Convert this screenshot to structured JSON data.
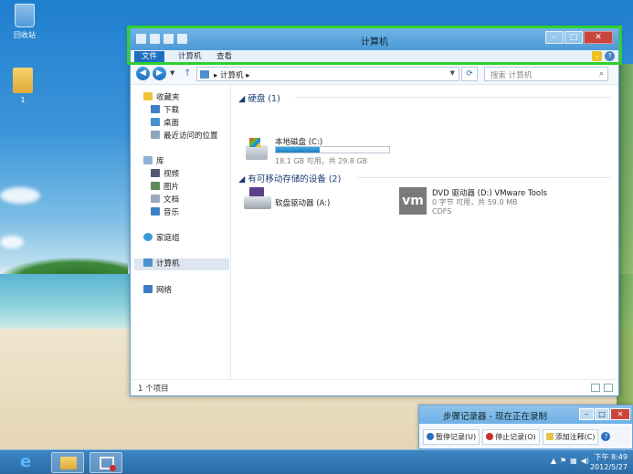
{
  "desktop": {
    "icons": [
      {
        "label": "回收站"
      },
      {
        "label": "1"
      }
    ]
  },
  "window": {
    "title": "计算机",
    "ribbon_tabs": [
      "文件",
      "计算机",
      "查看"
    ],
    "address": {
      "path": "计算机",
      "separator": "▸"
    },
    "search_placeholder": "搜索 计算机",
    "sidebar": {
      "favorites": {
        "label": "收藏夹",
        "items": [
          "下载",
          "桌面",
          "最近访问的位置"
        ]
      },
      "libraries": {
        "label": "库",
        "items": [
          "视频",
          "图片",
          "文档",
          "音乐"
        ]
      },
      "homegroup": "家庭组",
      "computer": "计算机",
      "network": "网络"
    },
    "groups": [
      {
        "header": "硬盘 (1)",
        "items": [
          {
            "name": "本地磁盘 (C:)",
            "detail": "18.1 GB 可用，共 29.8 GB",
            "used_fraction": 0.39
          }
        ]
      },
      {
        "header": "有可移动存储的设备 (2)",
        "items": [
          {
            "name": "软盘驱动器 (A:)"
          },
          {
            "name": "DVD 驱动器 (D:) VMware Tools",
            "detail": "0 字节 可用，共 59.0 MB",
            "fs": "CDFS"
          }
        ]
      }
    ],
    "status": "1 个项目"
  },
  "recorder": {
    "title": "步骤记录器 - 现在正在录制",
    "buttons": [
      "暂停记录(U)",
      "停止记录(O)",
      "添加注释(C)"
    ]
  },
  "taskbar": {
    "time": "下午 8:49",
    "date": "2012/5/27"
  },
  "colors": {
    "accent": "#1e6fc0",
    "highlight_border": "#2ed12e",
    "capacity_fill": "#1b7fc2"
  }
}
